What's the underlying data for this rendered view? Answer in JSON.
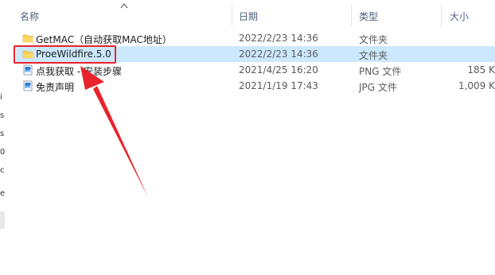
{
  "header": {
    "name": "名称",
    "date": "日期",
    "type": "类型",
    "size": "大小"
  },
  "files": [
    {
      "name": "GetMAC（自动获取MAC地址）",
      "date": "2022/2/23 14:36",
      "type": "文件夹",
      "size": "",
      "icon": "folder-icon",
      "selected": false
    },
    {
      "name": "ProeWildfire.5.0",
      "date": "2022/2/23 14:36",
      "type": "文件夹",
      "size": "",
      "icon": "folder-icon",
      "selected": true
    },
    {
      "name": "点我获取 - 安装步骤",
      "date": "2021/4/25 16:20",
      "type": "PNG 文件",
      "size": "185 K",
      "icon": "image-file-icon",
      "selected": false
    },
    {
      "name": "免责声明",
      "date": "2021/1/19 17:43",
      "type": "JPG 文件",
      "size": "1,009 K",
      "icon": "image-file-icon",
      "selected": false
    }
  ],
  "left_edge_chars": [
    "i",
    "s",
    "s",
    "0",
    "c",
    "e"
  ],
  "colors": {
    "selection": "#cce8ff",
    "folder": "#ffc83d",
    "annotation": "#e8232a",
    "header_text": "#4c607a"
  }
}
